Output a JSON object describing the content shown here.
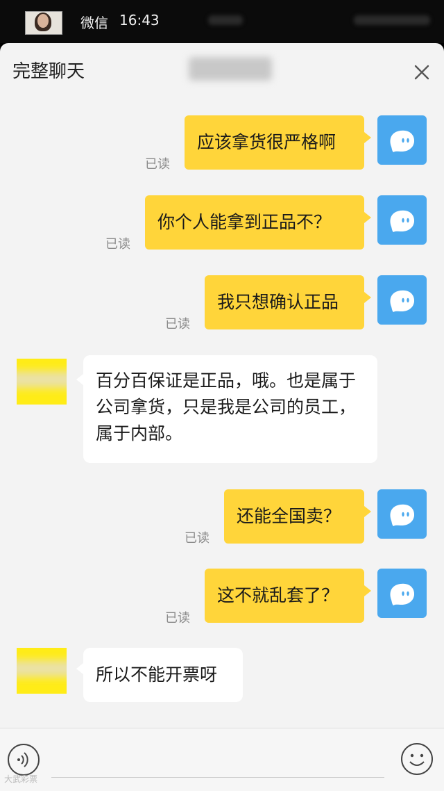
{
  "statusbar": {
    "app_name": "微信",
    "time": "16:43"
  },
  "header": {
    "title": "完整聊天"
  },
  "read_label": "已读",
  "messages": [
    {
      "from": "self",
      "text": "应该拿货很严格啊"
    },
    {
      "from": "self",
      "text": "你个人能拿到正品不？"
    },
    {
      "from": "self",
      "text": "我只想确认正品"
    },
    {
      "from": "peer",
      "text": "百分百保证是正品，哦。也是属于公司拿货，只是我是公司的员工，属于内部。"
    },
    {
      "from": "self",
      "text": "还能全国卖？"
    },
    {
      "from": "self",
      "text": "这不就乱套了？"
    },
    {
      "from": "peer",
      "text": "所以不能开票呀"
    }
  ],
  "watermark": "大武彩票",
  "colors": {
    "self_bubble": "#ffd53a",
    "self_avatar": "#4aa8ee",
    "peer_avatar": "#ffec17",
    "panel_bg": "#f3f3f3"
  }
}
